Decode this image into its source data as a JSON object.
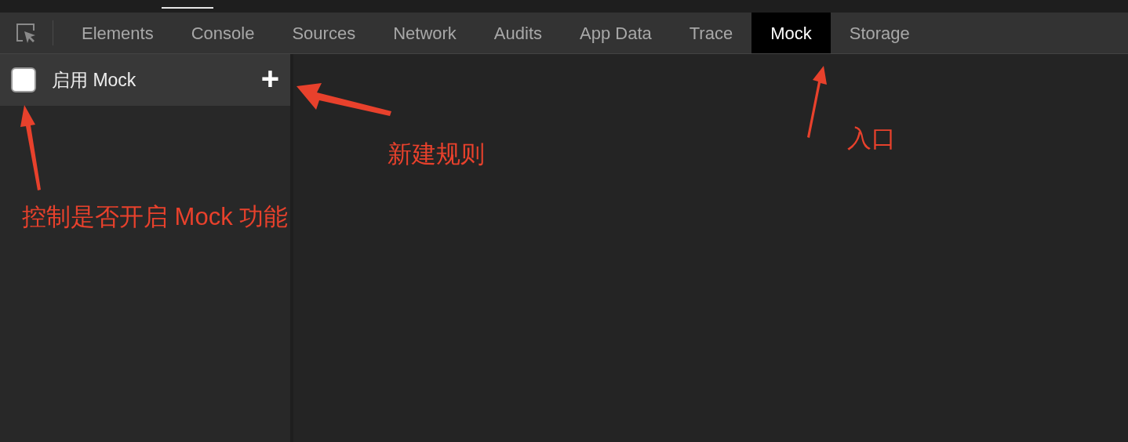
{
  "tabs": [
    {
      "label": "Elements",
      "selected": false
    },
    {
      "label": "Console",
      "selected": false
    },
    {
      "label": "Sources",
      "selected": false
    },
    {
      "label": "Network",
      "selected": false
    },
    {
      "label": "Audits",
      "selected": false
    },
    {
      "label": "App Data",
      "selected": false
    },
    {
      "label": "Trace",
      "selected": false
    },
    {
      "label": "Mock",
      "selected": true
    },
    {
      "label": "Storage",
      "selected": false
    }
  ],
  "mock_panel": {
    "enable_label": "启用 Mock",
    "checked": false,
    "add_button": "+"
  },
  "annotations": [
    {
      "text": "新建规则"
    },
    {
      "text": "入口"
    },
    {
      "text": "控制是否开启 Mock 功能"
    }
  ]
}
